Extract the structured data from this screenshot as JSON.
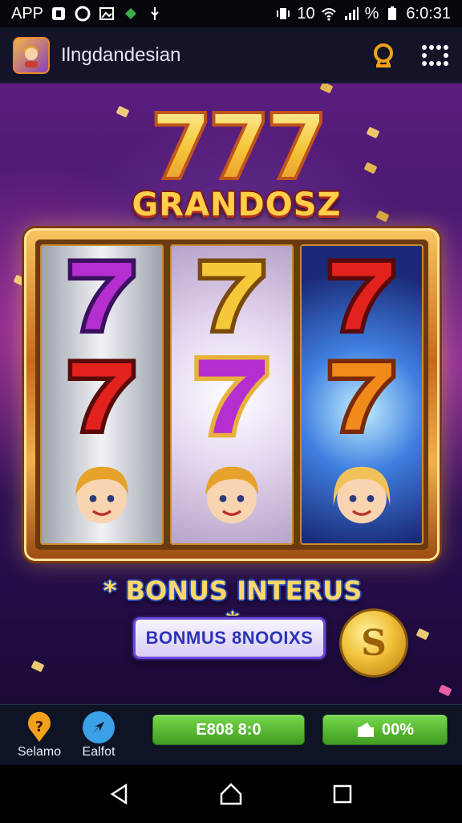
{
  "status_bar": {
    "left_label": "APP",
    "signal_text": "10",
    "battery_text": "%",
    "time": "6:0:31"
  },
  "header": {
    "title": "Ilngdandesian",
    "logo_icon": "avatar-app-logo",
    "right_icons": [
      "profile-ring-icon",
      "more-dots-icon"
    ]
  },
  "game": {
    "jackpot_digits": "777",
    "title": "GRANDOSZ",
    "reels": [
      {
        "symbols": [
          "seven-purple",
          "seven-red",
          "girl-face"
        ]
      },
      {
        "symbols": [
          "seven-gold",
          "seven-purple",
          "girl-face"
        ]
      },
      {
        "symbols": [
          "seven-red",
          "seven-orange",
          "girl-face"
        ]
      }
    ],
    "bonus_banner": "* BONUS INTERUS *",
    "bonus_button": "BONMUS 8NOOIXS",
    "coin_symbol": "S"
  },
  "bottom_bar": {
    "nav": [
      {
        "label": "Selamo",
        "icon": "help-pin-icon"
      },
      {
        "label": "Ealfot",
        "icon": "pointer-icon"
      }
    ],
    "balance_label": "E808 8:0",
    "percent_label": "00%",
    "percent_icon": "wallet-icon"
  },
  "system_nav": {
    "buttons": [
      "back",
      "home",
      "recents"
    ]
  },
  "colors": {
    "accent_gold": "#f2c23a",
    "pill_green": "#4fb52c",
    "bonus_blue": "#2b34b8",
    "bg_purple": "#3a1566"
  }
}
